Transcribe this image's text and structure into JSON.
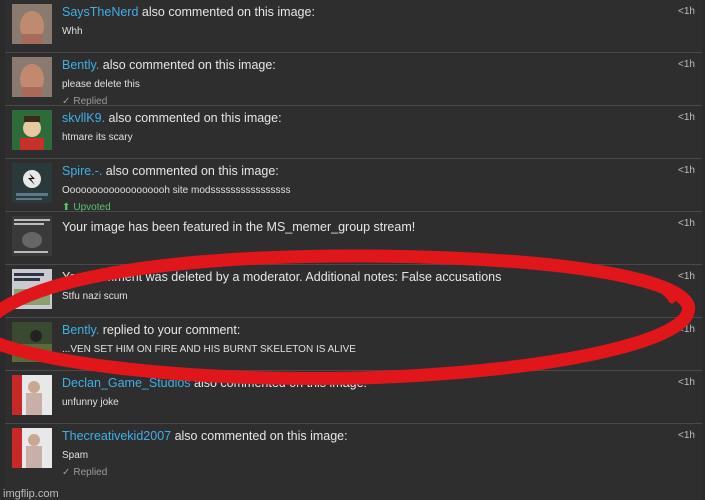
{
  "notifications": [
    {
      "user": "SaysTheNerd",
      "action": " also commented on this image:",
      "text": "Whh",
      "time": "<1h",
      "thumb_icon": "nerd-avatar-thumb",
      "thumb_color": "#a07060"
    },
    {
      "user": "Bently.",
      "action": " also commented on this image:",
      "text": "please delete this",
      "time": "<1h",
      "status": "Replied",
      "status_icon": "check-icon",
      "thumb_icon": "nerd-avatar-thumb",
      "thumb_color": "#a07060"
    },
    {
      "user": "skvllK9.",
      "action": " also commented on this image:",
      "text": "htmare its scary",
      "time": "<1h",
      "thumb_icon": "cartoon-avatar-thumb",
      "thumb_color": "#2f6a3a"
    },
    {
      "user": "Spire.-.",
      "action": " also commented on this image:",
      "text": "Ooooooooooooooooooh site modssssssssssssssss",
      "time": "<1h",
      "status": "Upvoted",
      "status_icon": "upvote-arrow-icon",
      "thumb_icon": "logo-thumb",
      "thumb_color": "#1a2a2a"
    },
    {
      "user": "",
      "action": "Your image has been featured in the MS_memer_group stream!",
      "text": "",
      "time": "<1h",
      "thumb_icon": "meme-thumb",
      "thumb_color": "#3a3a3a"
    },
    {
      "user": "",
      "action": "Your comment was deleted by a moderator. Additional notes: False accusations",
      "text": "Stfu nazi scum",
      "time": "<1h",
      "thumb_icon": "meme-thumb",
      "thumb_color": "#b0b8c0"
    },
    {
      "user": "Bently.",
      "action": " replied to your comment:",
      "text": "...VEN SET HIM ON FIRE AND HIS BURNT SKELETON IS ALIVE",
      "time": "<1h",
      "thumb_icon": "meme-thumb",
      "thumb_color": "#4a5a3a"
    },
    {
      "user": "Declan_Game_Studios",
      "action": " also commented on this image:",
      "text": "unfunny joke",
      "time": "<1h",
      "thumb_icon": "person-thumb",
      "thumb_color": "#b8a8a8"
    },
    {
      "user": "Thecreativekid2007",
      "action": " also commented on this image:",
      "text": "Spam",
      "time": "<1h",
      "status": "Replied",
      "status_icon": "check-icon",
      "thumb_icon": "person-thumb",
      "thumb_color": "#b8a8a8"
    }
  ],
  "watermark": "imgflip.com",
  "annotation_color": "#e0161b"
}
